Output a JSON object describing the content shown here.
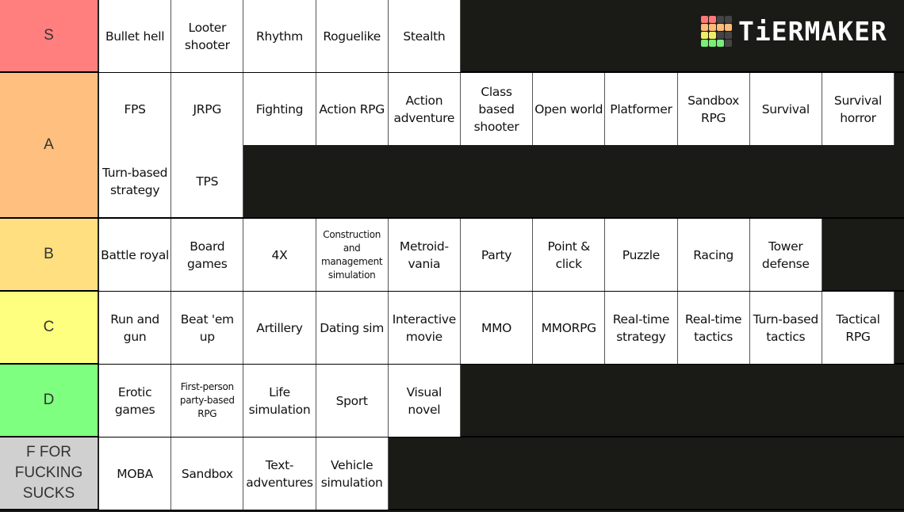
{
  "logo": {
    "text": "TiERMAKER",
    "squares": [
      "#f77",
      "#f77",
      "#444",
      "#444",
      "#fb7",
      "#fb7",
      "#fb7",
      "#fb7",
      "#ee6",
      "#ee6",
      "#444",
      "#444",
      "#7e7",
      "#7e7",
      "#7e7",
      "#444"
    ]
  },
  "tiers": [
    {
      "label": "S",
      "color": "#ff7f7f",
      "rows": 1,
      "items": [
        "Bullet hell",
        "Looter shooter",
        "Rhythm",
        "Roguelike",
        "Stealth"
      ]
    },
    {
      "label": "A",
      "color": "#ffbf7f",
      "rows": 2,
      "items": [
        "FPS",
        "JRPG",
        "Fighting",
        "Action RPG",
        "Action adventure",
        "Class based shooter",
        "Open world",
        "Platformer",
        "Sandbox RPG",
        "Survival",
        "Survival horror",
        "Turn-based strategy",
        "TPS"
      ]
    },
    {
      "label": "B",
      "color": "#ffdf7f",
      "rows": 1,
      "items": [
        "Battle royal",
        "Board games",
        "4X",
        "Construction and management simulation",
        "Metroid-vania",
        "Party",
        "Point & click",
        "Puzzle",
        "Racing",
        "Tower defense"
      ]
    },
    {
      "label": "C",
      "color": "#ffff7f",
      "rows": 1,
      "items": [
        "Run and gun",
        "Beat 'em up",
        "Artillery",
        "Dating sim",
        "Interactive movie",
        "MMO",
        "MMORPG",
        "Real-time strategy",
        "Real-time tactics",
        "Turn-based tactics",
        "Tactical RPG"
      ]
    },
    {
      "label": "D",
      "color": "#7fff7f",
      "rows": 1,
      "items": [
        "Erotic games",
        "First-person party-based RPG",
        "Life simulation",
        "Sport",
        "Visual novel"
      ]
    },
    {
      "label": "F FOR FUCKING SUCKS",
      "color": "#d0d0d0",
      "rows": 1,
      "items": [
        "MOBA",
        "Sandbox",
        "Text-adventures",
        "Vehicle simulation"
      ]
    }
  ]
}
